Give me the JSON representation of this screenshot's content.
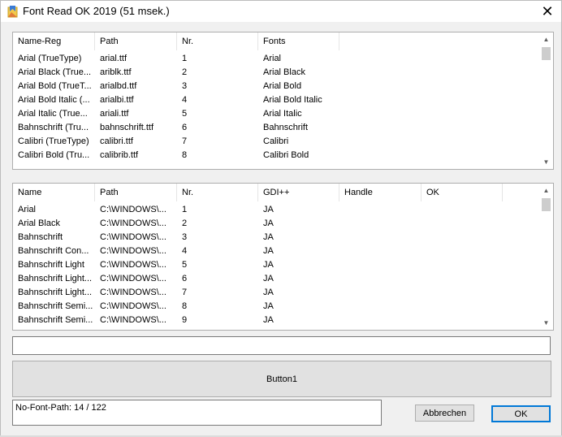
{
  "window": {
    "title": "Font Read OK 2019 (51 msek.)",
    "close_glyph": "✕"
  },
  "list1": {
    "columns": [
      "Name-Reg",
      "Path",
      "Nr.",
      "Fonts"
    ],
    "rows": [
      [
        "Arial (TrueType)",
        "arial.ttf",
        "1",
        "Arial"
      ],
      [
        "Arial Black (True...",
        "ariblk.ttf",
        "2",
        "Arial Black"
      ],
      [
        "Arial Bold (TrueT...",
        "arialbd.ttf",
        "3",
        "Arial Bold"
      ],
      [
        "Arial Bold Italic (...",
        "arialbi.ttf",
        "4",
        "Arial Bold Italic"
      ],
      [
        "Arial Italic (True...",
        "ariali.ttf",
        "5",
        "Arial Italic"
      ],
      [
        "Bahnschrift (Tru...",
        "bahnschrift.ttf",
        "6",
        "Bahnschrift"
      ],
      [
        "Calibri (TrueType)",
        "calibri.ttf",
        "7",
        "Calibri"
      ],
      [
        "Calibri Bold (Tru...",
        "calibrib.ttf",
        "8",
        "Calibri Bold"
      ]
    ]
  },
  "list2": {
    "columns": [
      "Name",
      "Path",
      "Nr.",
      "GDI++",
      "Handle",
      "OK"
    ],
    "rows": [
      [
        "Arial",
        "C:\\WINDOWS\\...",
        "1",
        "JA",
        "",
        ""
      ],
      [
        "Arial Black",
        "C:\\WINDOWS\\...",
        "2",
        "JA",
        "",
        ""
      ],
      [
        "Bahnschrift",
        "C:\\WINDOWS\\...",
        "3",
        "JA",
        "",
        ""
      ],
      [
        "Bahnschrift Con...",
        "C:\\WINDOWS\\...",
        "4",
        "JA",
        "",
        ""
      ],
      [
        "Bahnschrift Light",
        "C:\\WINDOWS\\...",
        "5",
        "JA",
        "",
        ""
      ],
      [
        "Bahnschrift Light...",
        "C:\\WINDOWS\\...",
        "6",
        "JA",
        "",
        ""
      ],
      [
        "Bahnschrift Light...",
        "C:\\WINDOWS\\...",
        "7",
        "JA",
        "",
        ""
      ],
      [
        "Bahnschrift Semi...",
        "C:\\WINDOWS\\...",
        "8",
        "JA",
        "",
        ""
      ],
      [
        "Bahnschrift Semi...",
        "C:\\WINDOWS\\...",
        "9",
        "JA",
        "",
        ""
      ]
    ]
  },
  "edit": {
    "value": ""
  },
  "button1": {
    "label": "Button1"
  },
  "status": {
    "text": "No-Font-Path: 14 / 122"
  },
  "buttons": {
    "cancel": "Abbrechen",
    "ok": "OK"
  },
  "icons": {
    "app": "app-folder-icon",
    "close": "close-icon",
    "up": "scroll-up-arrow-icon",
    "down": "scroll-down-arrow-icon"
  }
}
